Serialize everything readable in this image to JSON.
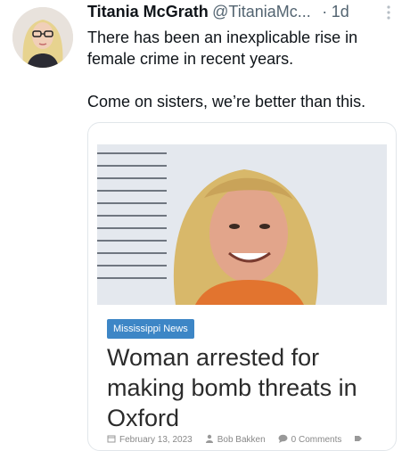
{
  "tweet": {
    "author_name": "Titania McGrath",
    "author_handle": "@TitaniaMc...",
    "separator": "·",
    "time": "1d",
    "text_line1": "There has been an inexplicable rise in female crime in recent years.",
    "text_line2": "Come on sisters, we’re better than this."
  },
  "card": {
    "category": "Mississippi News",
    "headline": "Woman arrested for making bomb threats in Oxford",
    "date": "February 13, 2023",
    "author": "Bob Bakken",
    "comments": "0 Comments"
  },
  "colors": {
    "tag_bg": "#3d86c6",
    "handle_gray": "#536471"
  },
  "icons": [
    "more-icon",
    "calendar-icon",
    "user-icon",
    "comment-icon",
    "share-icon"
  ]
}
